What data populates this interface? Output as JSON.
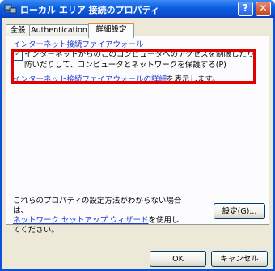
{
  "window": {
    "title": "ローカル エリア 接続のプロパティ",
    "help_label": "?",
    "close_label": "✕"
  },
  "tabs": [
    {
      "label": "全般"
    },
    {
      "label": "Authentication"
    },
    {
      "label": "詳細設定"
    }
  ],
  "firewall": {
    "section_label": "インターネット接続ファイアウォール",
    "option_label": "インターネットからのこのコンピュータへのアクセスを制限したり防いだりして、コンピュータとネットワークを保護する(P)",
    "checked": true,
    "link_partial": "インターネット接続ファイアウォールの詳細",
    "link_suffix": "を表示します。"
  },
  "help_text": {
    "line1": "これらのプロパティの設定方法がわからない場合は、",
    "wizard_link": "ネットワーク セットアップ ウィザード",
    "line2_suffix": "を使用してください。"
  },
  "buttons": {
    "settings": "設定(G)...",
    "ok": "OK",
    "cancel": "キャンセル"
  },
  "colors": {
    "accent": "#0a5ee0",
    "link": "#1c3bd1",
    "highlight": "#e00000"
  }
}
